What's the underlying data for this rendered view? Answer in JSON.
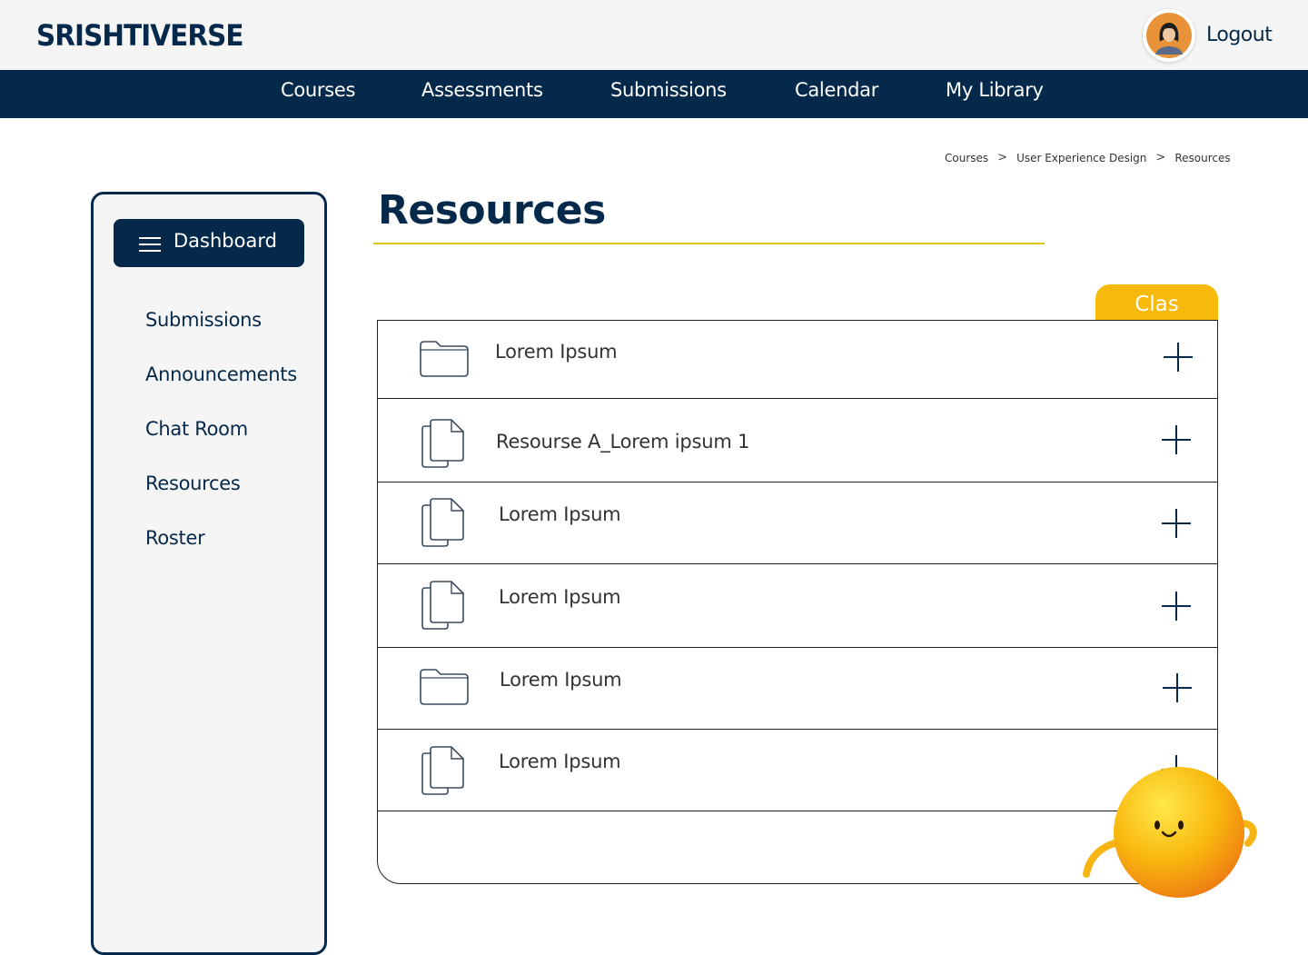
{
  "header": {
    "logo": "SRISHTIVERSE",
    "logout_label": "Logout"
  },
  "nav": {
    "items": [
      "Courses",
      "Assessments",
      "Submissions",
      "Calendar",
      "My Library"
    ]
  },
  "breadcrumb": {
    "items": [
      "Courses",
      "User Experience Design",
      "Resources"
    ]
  },
  "sidebar": {
    "dashboard_label": "Dashboard",
    "items": [
      "Submissions",
      "Announcements",
      "Chat Room",
      "Resources",
      "Roster"
    ]
  },
  "main": {
    "title": "Resources",
    "tab_label": "Clas",
    "rows": [
      {
        "label": "Lorem Ipsum",
        "icon": "folder-icon"
      },
      {
        "label": "Resourse A_Lorem ipsum 1",
        "icon": "documents-icon"
      },
      {
        "label": "Lorem Ipsum",
        "icon": "documents-icon"
      },
      {
        "label": "Lorem Ipsum",
        "icon": "documents-icon"
      },
      {
        "label": "Lorem Ipsum",
        "icon": "folder-icon"
      },
      {
        "label": "Lorem Ipsum",
        "icon": "documents-icon"
      }
    ]
  },
  "colors": {
    "primary": "#04294a",
    "accent": "#f6b90c",
    "underline": "#e6c400"
  }
}
